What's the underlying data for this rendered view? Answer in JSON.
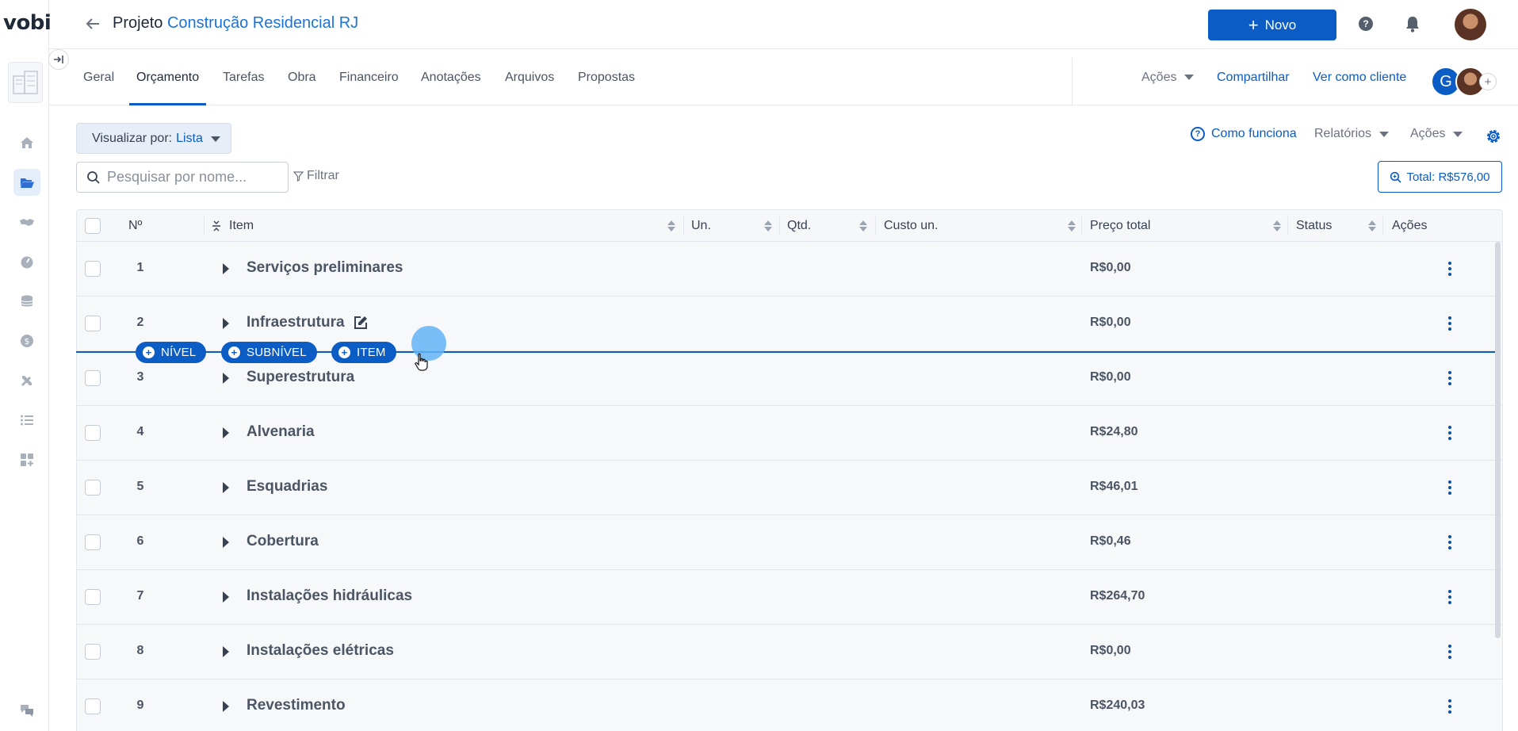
{
  "app": {
    "logo": "vobi"
  },
  "header": {
    "title_prefix": "Projeto",
    "project_name": "Construção Residencial RJ",
    "new_button": "Novo",
    "help_symbol": "?"
  },
  "tabs": [
    {
      "label": "Geral",
      "active": false
    },
    {
      "label": "Orçamento",
      "active": true
    },
    {
      "label": "Tarefas",
      "active": false
    },
    {
      "label": "Obra",
      "active": false
    },
    {
      "label": "Financeiro",
      "active": false
    },
    {
      "label": "Anotações",
      "active": false
    },
    {
      "label": "Arquivos",
      "active": false
    },
    {
      "label": "Propostas",
      "active": false
    }
  ],
  "tab_actions": {
    "acoes": "Ações",
    "compartilhar": "Compartilhar",
    "ver_como_cliente": "Ver como cliente",
    "avatar_initial": "G",
    "add_symbol": "+"
  },
  "toolbar": {
    "view_label": "Visualizar por:",
    "view_value": "Lista",
    "como_funciona": "Como funciona",
    "relatorios": "Relatórios",
    "acoes": "Ações",
    "search_placeholder": "Pesquisar por nome...",
    "filter": "Filtrar",
    "total": "Total: R$576,00"
  },
  "table": {
    "columns": [
      "Nº",
      "Item",
      "Un.",
      "Qtd.",
      "Custo un.",
      "Preço total",
      "Status",
      "Ações"
    ],
    "rows": [
      {
        "num": "1",
        "label": "Serviços preliminares",
        "price": "R$0,00"
      },
      {
        "num": "2",
        "label": "Infraestrutura",
        "price": "R$0,00"
      },
      {
        "num": "3",
        "label": "Superestrutura",
        "price": "R$0,00"
      },
      {
        "num": "4",
        "label": "Alvenaria",
        "price": "R$24,80"
      },
      {
        "num": "5",
        "label": "Esquadrias",
        "price": "R$46,01"
      },
      {
        "num": "6",
        "label": "Cobertura",
        "price": "R$0,46"
      },
      {
        "num": "7",
        "label": "Instalações hidráulicas",
        "price": "R$264,70"
      },
      {
        "num": "8",
        "label": "Instalações elétricas",
        "price": "R$0,00"
      },
      {
        "num": "9",
        "label": "Revestimento",
        "price": "R$240,03"
      }
    ]
  },
  "insert_bar": {
    "nivel": "NÍVEL",
    "subnivel": "SUBNÍVEL",
    "item": "ITEM",
    "plus": "+"
  },
  "colors": {
    "primary": "#0b5cc5",
    "row_bg": "#f7f8fa",
    "cursor_highlight": "#63b4f5"
  }
}
